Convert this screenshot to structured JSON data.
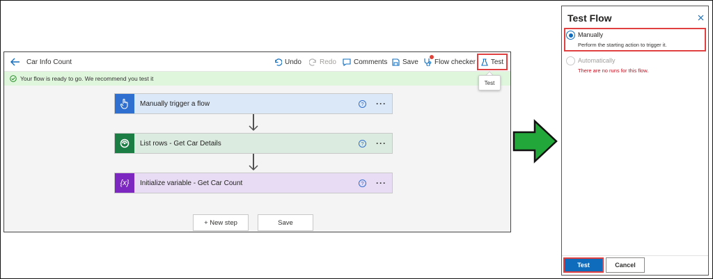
{
  "designer": {
    "flow_name": "Car Info Count",
    "toolbar": {
      "undo": "Undo",
      "redo": "Redo",
      "comments": "Comments",
      "save": "Save",
      "flow_checker": "Flow checker",
      "test": "Test"
    },
    "banner": "Your flow is ready to go. We recommend you test it",
    "tooltip": "Test",
    "steps": [
      {
        "title": "Manually trigger a flow",
        "icon": "hand-touch-icon",
        "color": "#2f6fcf",
        "bg": "#dbe8f8"
      },
      {
        "title": "List rows - Get Car Details",
        "icon": "dataverse-icon",
        "color": "#1b7d43",
        "bg": "#dcebe0"
      },
      {
        "title": "Initialize variable - Get Car Count",
        "icon": "variable-icon",
        "color": "#7b27c0",
        "icon_text": "{x}",
        "bg": "#e8dcf4"
      }
    ],
    "bottom_buttons": {
      "new_step": "+ New step",
      "save": "Save"
    }
  },
  "test_panel": {
    "title": "Test Flow",
    "options": [
      {
        "label": "Manually",
        "description": "Perform the starting action to trigger it.",
        "selected": true,
        "enabled": true
      },
      {
        "label": "Automatically",
        "description": "There are no runs for this flow.",
        "selected": false,
        "enabled": false
      }
    ],
    "buttons": {
      "test": "Test",
      "cancel": "Cancel"
    }
  },
  "colors": {
    "accent": "#0f6cbd",
    "highlight_border": "#e04040",
    "arrow_fill": "#22a83a",
    "banner_bg": "#dff6dd",
    "error_text": "#c50f1f"
  }
}
